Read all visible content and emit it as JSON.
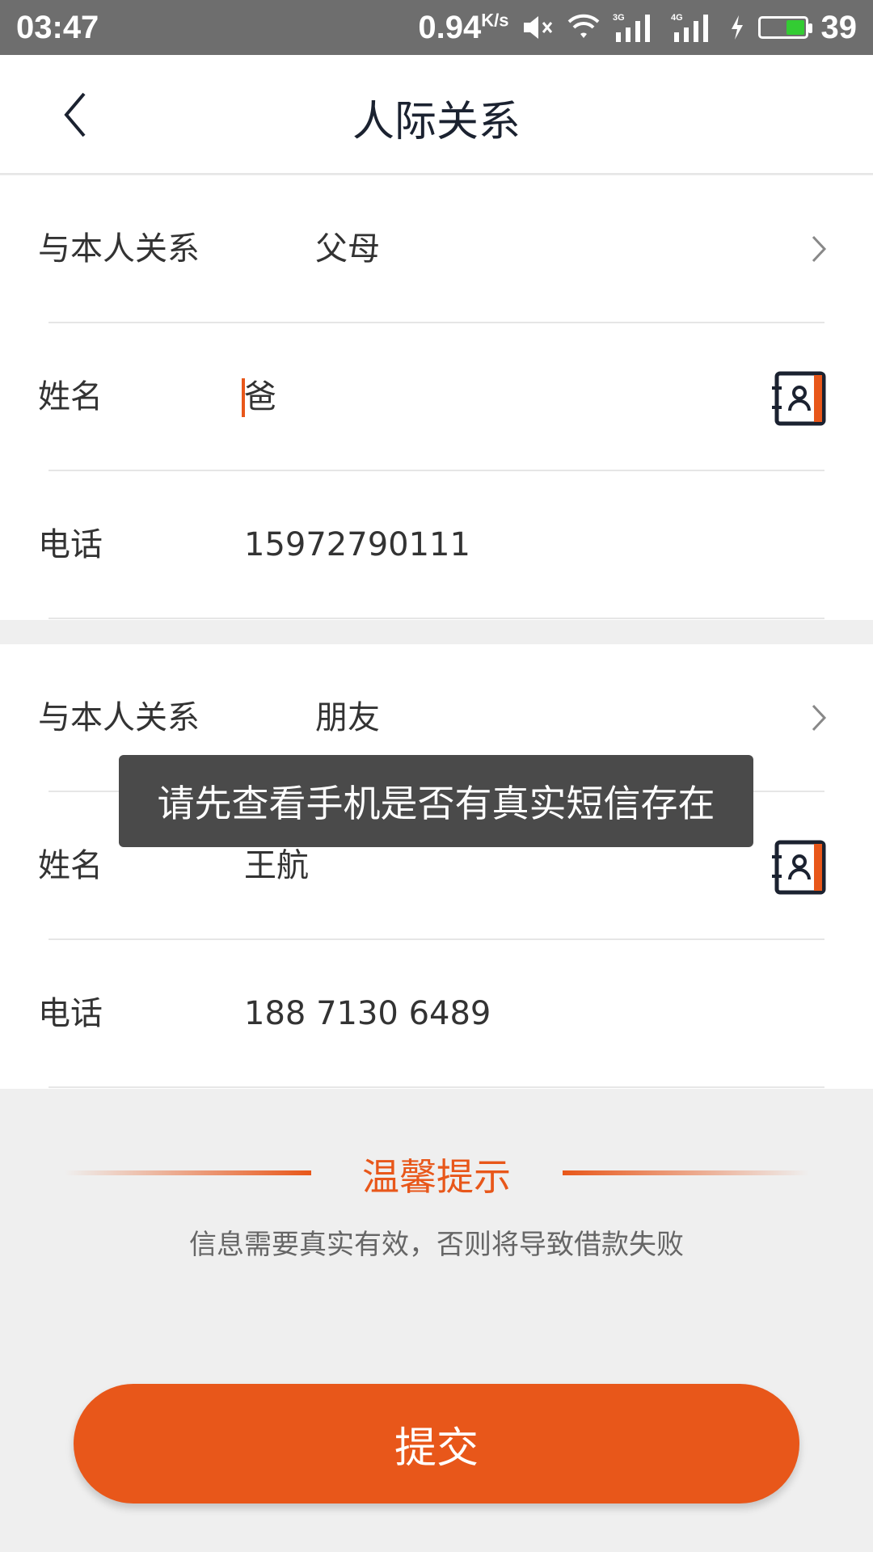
{
  "status_bar": {
    "time": "03:47",
    "speed": "0.94",
    "speed_unit": "K/s",
    "network_3g": "3G",
    "network_4g": "4G",
    "battery": "39"
  },
  "header": {
    "title": "人际关系"
  },
  "contacts": [
    {
      "relation_label": "与本人关系",
      "relation_value": "父母",
      "name_label": "姓名",
      "name_value": "爸",
      "phone_label": "电话",
      "phone_value": "15972790111"
    },
    {
      "relation_label": "与本人关系",
      "relation_value": "朋友",
      "name_label": "姓名",
      "name_value": "王航",
      "phone_label": "电话",
      "phone_value": "188 7130 6489"
    }
  ],
  "tip": {
    "title": "温馨提示",
    "text": "信息需要真实有效，否则将导致借款失败"
  },
  "submit": {
    "label": "提交"
  },
  "toast": {
    "text": "请先查看手机是否有真实短信存在"
  },
  "colors": {
    "accent": "#e8571a",
    "status_bar": "#6e6e6e",
    "toast": "#4a4a4a"
  }
}
